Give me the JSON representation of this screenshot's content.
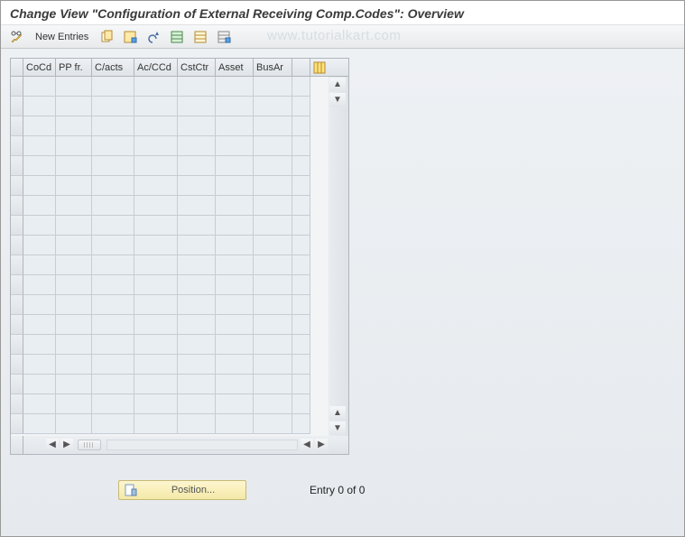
{
  "title_bar": {
    "title": "Change View \"Configuration of External Receiving Comp.Codes\": Overview"
  },
  "toolbar": {
    "new_entries_label": "New Entries",
    "icons": {
      "pencil": "display-change-toggle-icon",
      "copy": "copy-as-icon",
      "delete": "delete-icon",
      "undo": "undo-icon",
      "select_all": "select-all-icon",
      "select_block": "select-block-icon",
      "deselect_all": "deselect-all-icon"
    }
  },
  "watermark": "www.tutorialkart.com",
  "grid": {
    "columns": [
      {
        "key": "CoCd",
        "label": "CoCd",
        "width": 36
      },
      {
        "key": "PPfr",
        "label": "PP fr.",
        "width": 40
      },
      {
        "key": "Cacts",
        "label": "C/acts",
        "width": 47
      },
      {
        "key": "AcCCd",
        "label": "Ac/CCd",
        "width": 48
      },
      {
        "key": "CstCtr",
        "label": "CstCtr",
        "width": 42
      },
      {
        "key": "Asset",
        "label": "Asset",
        "width": 42
      },
      {
        "key": "BusAr",
        "label": "BusAr",
        "width": 43
      },
      {
        "key": "pad",
        "label": "",
        "width": 20
      }
    ],
    "row_count": 18,
    "rows": []
  },
  "footer": {
    "position_label": "Position...",
    "entry_text": "Entry 0 of 0"
  }
}
